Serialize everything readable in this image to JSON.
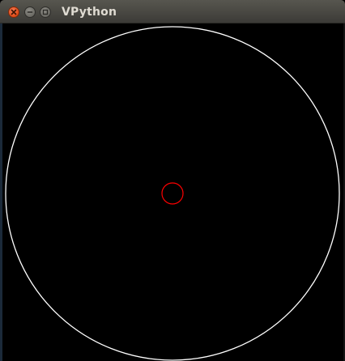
{
  "window": {
    "title": "VPython"
  },
  "titlebar_icons": {
    "close": "close-icon",
    "minimize": "minimize-icon",
    "maximize": "maximize-icon"
  },
  "scene": {
    "background_color": "#000000",
    "objects": [
      {
        "name": "orbit-path",
        "color": "#ffffff"
      },
      {
        "name": "body",
        "color": "#ff0000"
      }
    ]
  }
}
